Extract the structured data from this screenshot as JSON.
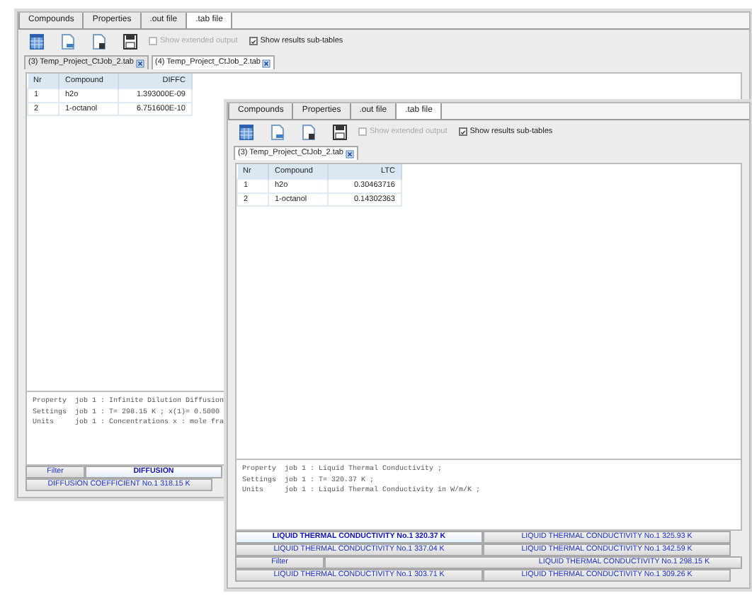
{
  "windows": [
    {
      "tabs": [
        {
          "label": "Compounds",
          "selected": false
        },
        {
          "label": "Properties",
          "selected": false
        },
        {
          "label": ".out file",
          "selected": false
        },
        {
          "label": ".tab file",
          "selected": true
        }
      ],
      "options": [
        {
          "label": "Show extended output",
          "checked": false,
          "disabled": true
        },
        {
          "label": "Show results sub-tables",
          "checked": true,
          "disabled": false
        }
      ],
      "doc_tabs": [
        {
          "label": "(3) Temp_Project_CtJob_2.tab",
          "selected": false
        },
        {
          "label": "(4) Temp_Project_CtJob_2.tab",
          "selected": true
        }
      ],
      "table": {
        "columns": [
          "Nr",
          "Compound",
          "DIFFC"
        ],
        "rows": [
          [
            "1",
            "h2o",
            "1.393000E-09"
          ],
          [
            "2",
            "1-octanol",
            "6.751600E-10"
          ]
        ]
      },
      "info": [
        {
          "label": "Property",
          "text": "job 1 : Infinite Dilution Diffusion"
        },
        {
          "label": "Settings",
          "text": "job 1 : T= 298.15 K ; x(1)= 0.5000"
        },
        {
          "label": "Units",
          "text": "job 1 : Concentrations x : mole fra"
        }
      ],
      "result_rows": [
        [
          {
            "kind": "filter",
            "label": "Filter",
            "selected": false
          },
          {
            "kind": "result",
            "label": "DIFFUSION",
            "selected": true
          }
        ],
        [
          {
            "kind": "result",
            "label": "DIFFUSION COEFFICIENT No.1 318.15 K",
            "selected": false
          }
        ]
      ]
    },
    {
      "tabs": [
        {
          "label": "Compounds",
          "selected": false
        },
        {
          "label": "Properties",
          "selected": false
        },
        {
          "label": ".out file",
          "selected": false
        },
        {
          "label": ".tab file",
          "selected": true
        }
      ],
      "options": [
        {
          "label": "Show extended output",
          "checked": false,
          "disabled": true
        },
        {
          "label": "Show results sub-tables",
          "checked": true,
          "disabled": false
        }
      ],
      "doc_tabs": [
        {
          "label": "(3) Temp_Project_CtJob_2.tab",
          "selected": true
        }
      ],
      "table": {
        "columns": [
          "Nr",
          "Compound",
          "LTC"
        ],
        "rows": [
          [
            "1",
            "h2o",
            "0.30463716"
          ],
          [
            "2",
            "1-octanol",
            "0.14302363"
          ]
        ]
      },
      "info": [
        {
          "label": "Property",
          "text": "job 1 : Liquid Thermal Conductivity ;"
        },
        {
          "label": "Settings",
          "text": "job 1 : T= 320.37 K ;"
        },
        {
          "label": "Units",
          "text": "job 1 : Liquid Thermal Conductivity in W/m/K ;"
        }
      ],
      "result_rows": [
        [
          {
            "kind": "result",
            "label": "LIQUID THERMAL CONDUCTIVITY No.1 320.37 K",
            "selected": true
          },
          {
            "kind": "result",
            "label": "LIQUID THERMAL CONDUCTIVITY No.1 325.93 K",
            "selected": false
          }
        ],
        [
          {
            "kind": "result",
            "label": "LIQUID THERMAL CONDUCTIVITY No.1 337.04 K",
            "selected": false
          },
          {
            "kind": "result",
            "label": "LIQUID THERMAL CONDUCTIVITY No.1 342.59 K",
            "selected": false
          }
        ],
        [
          {
            "kind": "filter",
            "label": "Filter",
            "selected": false
          },
          {
            "kind": "result",
            "label": "LIQUID THERMAL CONDUCTIVITY No.1 298.15 K",
            "selected": false
          }
        ],
        [
          {
            "kind": "result",
            "label": "LIQUID THERMAL CONDUCTIVITY No.1 303.71 K",
            "selected": false
          },
          {
            "kind": "result",
            "label": "LIQUID THERMAL CONDUCTIVITY No.1 309.26 K",
            "selected": false
          }
        ]
      ]
    }
  ]
}
